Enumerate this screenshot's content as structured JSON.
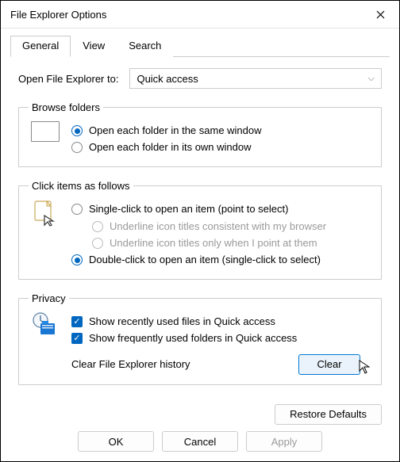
{
  "title": "File Explorer Options",
  "tabs": [
    "General",
    "View",
    "Search"
  ],
  "openExplorer": {
    "label": "Open File Explorer to:",
    "value": "Quick access"
  },
  "browse": {
    "legend": "Browse folders",
    "opt1": "Open each folder in the same window",
    "opt2": "Open each folder in its own window"
  },
  "click": {
    "legend": "Click items as follows",
    "single": "Single-click to open an item (point to select)",
    "ul1": "Underline icon titles consistent with my browser",
    "ul2": "Underline icon titles only when I point at them",
    "double": "Double-click to open an item (single-click to select)"
  },
  "privacy": {
    "legend": "Privacy",
    "recent": "Show recently used files in Quick access",
    "frequent": "Show frequently used folders in Quick access",
    "clearLabel": "Clear File Explorer history",
    "clearBtn": "Clear"
  },
  "restore": "Restore Defaults",
  "footer": {
    "ok": "OK",
    "cancel": "Cancel",
    "apply": "Apply"
  }
}
